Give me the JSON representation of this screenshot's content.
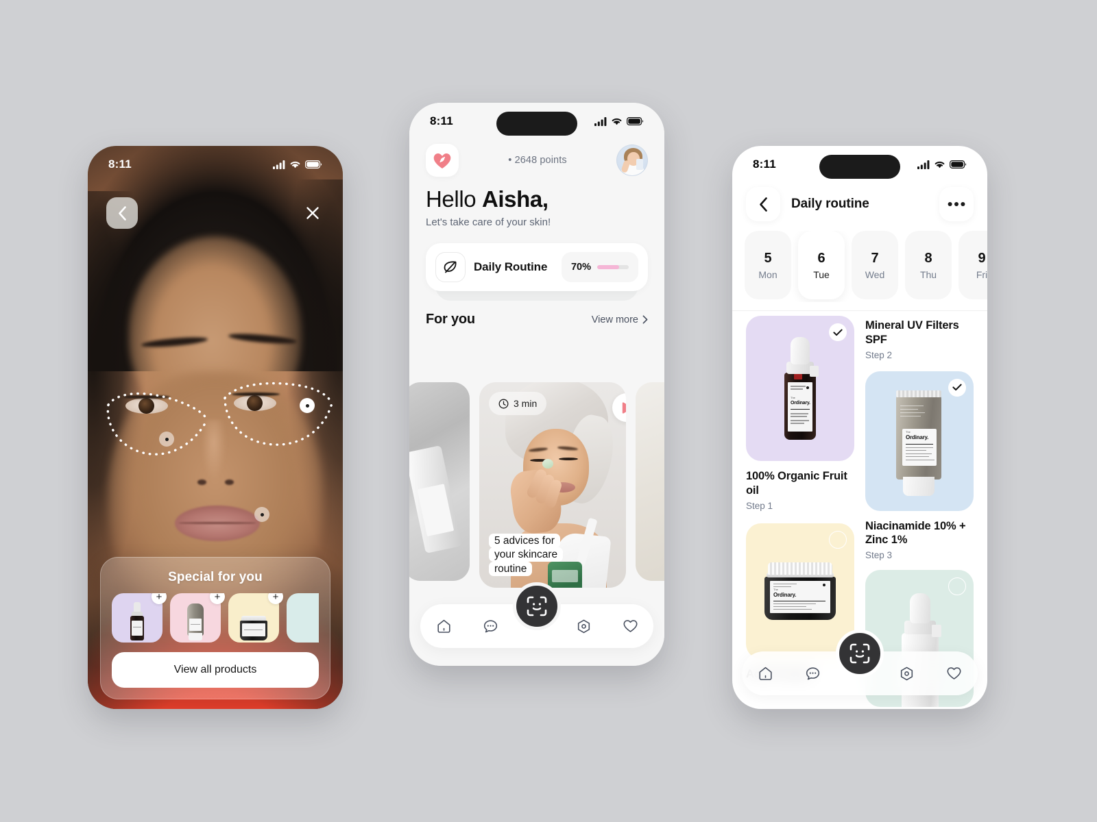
{
  "background_color": "#cfd0d3",
  "accent_pink": "#f5b6d6",
  "accent_coral": "#ef7b7b",
  "phone1": {
    "status": {
      "time": "8:11",
      "signal_icon": "cellular-signal-icon",
      "wifi_icon": "wifi-icon",
      "battery_icon": "battery-icon"
    },
    "back_icon": "chevron-left-icon",
    "close_icon": "close-icon",
    "scan": {
      "markers": [
        "scan-marker-right-cheek",
        "scan-marker-left-cheek",
        "scan-marker-chin"
      ],
      "regions": [
        "under-eye-left",
        "under-eye-right"
      ]
    },
    "panel": {
      "title": "Special for you",
      "products": [
        {
          "name": "serum-dropper",
          "swatch": "#ded4f0",
          "add_label": "+"
        },
        {
          "name": "moisturizer-tube",
          "swatch": "#f7d7df",
          "add_label": "+"
        },
        {
          "name": "cream-jar",
          "swatch": "#f9eecb",
          "add_label": "+"
        },
        {
          "name": "mint-product",
          "swatch": "#d9ecea",
          "add_label": ""
        }
      ],
      "cta_label": "View all products"
    }
  },
  "phone2": {
    "status": {
      "time": "8:11",
      "signal_icon": "cellular-signal-icon",
      "wifi_icon": "wifi-icon",
      "battery_icon": "battery-icon"
    },
    "brand_icon": "heart-leaf-logo-icon",
    "points_label": "• 2648 points",
    "avatar_name": "user-avatar",
    "greeting_prefix": "Hello ",
    "greeting_name": "Aisha,",
    "subtitle": "Let's take care of your skin!",
    "routine": {
      "icon": "leaf-icon",
      "label": "Daily Routine",
      "progress_label": "70%",
      "progress_value": 70
    },
    "section": {
      "title": "For you",
      "link_label": "View more",
      "link_icon": "chevron-right-icon"
    },
    "carousel": {
      "duration_label": "3 min",
      "clock_icon": "clock-icon",
      "play_icon": "play-icon",
      "caption_lines": [
        "5 advices for",
        "your skincare",
        "routine"
      ]
    },
    "tabs": [
      {
        "name": "tab-home",
        "icon": "home-icon"
      },
      {
        "name": "tab-messages",
        "icon": "chat-bubble-icon"
      },
      {
        "name": "tab-scan",
        "icon": "face-scan-icon"
      },
      {
        "name": "tab-discover",
        "icon": "hexagon-camera-icon"
      },
      {
        "name": "tab-favorites",
        "icon": "heart-icon"
      }
    ]
  },
  "phone3": {
    "status": {
      "time": "8:11",
      "signal_icon": "cellular-signal-icon",
      "wifi_icon": "wifi-icon",
      "battery_icon": "battery-icon"
    },
    "header": {
      "back_icon": "chevron-left-icon",
      "title": "Daily routine",
      "more_icon": "more-horizontal-icon"
    },
    "days": [
      {
        "num": "5",
        "day": "Mon",
        "active": false
      },
      {
        "num": "6",
        "day": "Tue",
        "active": true
      },
      {
        "num": "7",
        "day": "Wed",
        "active": false
      },
      {
        "num": "8",
        "day": "Thu",
        "active": false
      },
      {
        "num": "9",
        "day": "Fri",
        "active": false
      }
    ],
    "products": [
      {
        "title": "100% Organic Fruit oil",
        "step": "Step 1",
        "swatch": "#e4dbf3",
        "checked": true,
        "art": "dropper-dark"
      },
      {
        "title": "Mineral UV Filters SPF",
        "step": "Step 2",
        "swatch": "#d4e4f3",
        "checked": true,
        "art": "tube-grey"
      },
      {
        "title": "Niacinamide 10% + Zinc 1%",
        "step": "Step 3",
        "swatch": "#fbf1d2",
        "checked": false,
        "art": "jar-dark"
      },
      {
        "title": "Acid Powder",
        "step": "",
        "swatch": "#dcece6",
        "checked": false,
        "art": "dropper-white"
      }
    ],
    "tabs": [
      {
        "name": "tab-home",
        "icon": "home-icon"
      },
      {
        "name": "tab-messages",
        "icon": "chat-bubble-icon"
      },
      {
        "name": "tab-scan",
        "icon": "face-scan-icon"
      },
      {
        "name": "tab-discover",
        "icon": "hexagon-camera-icon"
      },
      {
        "name": "tab-favorites",
        "icon": "heart-icon"
      }
    ]
  }
}
